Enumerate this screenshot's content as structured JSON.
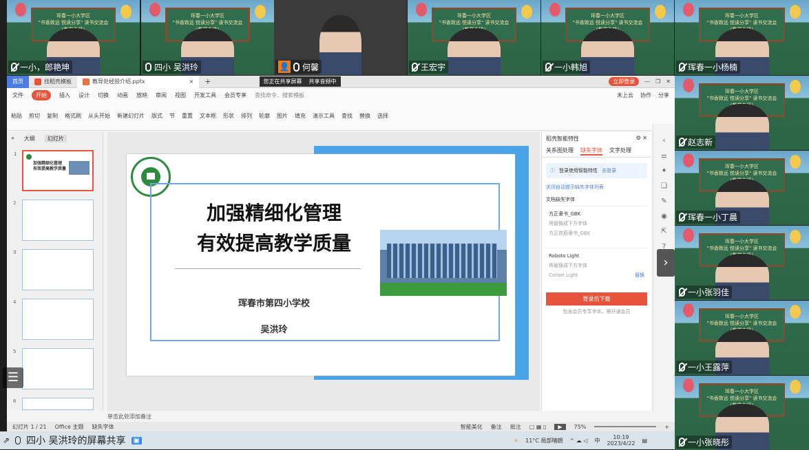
{
  "participants_top": [
    {
      "name": "一小，郎艳坤",
      "mic": "off"
    },
    {
      "name": "四小 吴洪玲",
      "mic": "on"
    },
    {
      "name": "何馨",
      "mic": "on",
      "avatar_icon": "person-icon"
    },
    {
      "name": "王宏宇",
      "mic": "off"
    },
    {
      "name": "一小韩旭",
      "mic": "off"
    },
    {
      "name": "珲春一小杨楠",
      "mic": "off"
    }
  ],
  "participants_right": [
    {
      "name": "赵志新",
      "mic": "off"
    },
    {
      "name": "珲春一小丁晨",
      "mic": "off"
    },
    {
      "name": "一小张羽佳",
      "mic": "off"
    },
    {
      "name": "一小王露萍",
      "mic": "off"
    },
    {
      "name": "一小张晓彤",
      "mic": "off"
    }
  ],
  "board_text": {
    "line1": "珲春一小大学区",
    "line2": "\"书香致远 悦读分享\" 读书交流会",
    "line3": "（教学专场）"
  },
  "app": {
    "tab_home": "首页",
    "tab_template": "找稻壳模板",
    "tab_file": "教导处经验介绍.pptx",
    "sharing_label": "您正在共享屏幕",
    "sharing_audio": "共享音频中",
    "login_btn": "立即登录"
  },
  "ribbon_tabs": [
    "文件",
    "开始",
    "插入",
    "设计",
    "切换",
    "动画",
    "放映",
    "审阅",
    "视图",
    "开发工具",
    "会员专享"
  ],
  "search_placeholder": "查找命令、搜索模板",
  "ribbon_right": [
    "未上云",
    "协作",
    "分享"
  ],
  "ribbon_tools": [
    "粘贴",
    "剪切",
    "复制",
    "格式刷",
    "从头开始",
    "新建幻灯片",
    "版式",
    "节",
    "重置",
    "文本框",
    "形状",
    "排列",
    "轮廓",
    "图片",
    "填充",
    "演示工具",
    "查找",
    "替换",
    "选择"
  ],
  "panel_tabs": {
    "outline": "大纲",
    "slides": "幻灯片"
  },
  "slide": {
    "title1": "加强精细化管理",
    "title2": "有效提高教学质量",
    "school": "珲春市第四小学校",
    "author": "吴洪玲"
  },
  "pane": {
    "header": "稻壳智能特性",
    "tabs": [
      "关系图处理",
      "缺失字体",
      "文字处理"
    ],
    "notice": "登录使用智能特性",
    "notice_link": "去登录",
    "auto_link": "关闭自动提示缺失字体列表",
    "section": "文档缺失字体",
    "font1": "方正隶书_GBK",
    "font1_replace_label": "将替换成下方字体",
    "font1_replace": "方正铁筋隶书_GBK",
    "font2": "Roboto Light",
    "font2_replace_label": "将替换成下方字体",
    "font2_replace": "Corbel Light",
    "font2_link": "替换",
    "download_btn": "登录后下载",
    "footer": "包含会员专享字体，需开通会员"
  },
  "notes_placeholder": "单击此处添加备注",
  "status": {
    "slide_count": "幻灯片 1 / 21",
    "theme": "Office 主题",
    "missing_font": "缺失字体",
    "beautify": "智能美化",
    "notes": "备注",
    "comment": "批注",
    "zoom": "75%"
  },
  "taskbar": {
    "weather": "11°C 局部晴朗",
    "time": "10:19",
    "date": "2023/4/22",
    "ime": "中"
  },
  "share_label": "四小 吴洪玲的屏幕共享",
  "colors": {
    "accent": "#e8543b",
    "share_border": "#2bd24c",
    "blue": "#4a90e2"
  }
}
